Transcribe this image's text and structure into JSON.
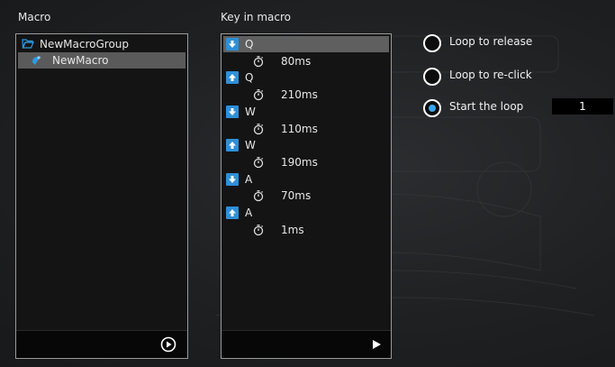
{
  "macro_panel": {
    "title": "Macro",
    "group_label": "NewMacroGroup",
    "item_label": "NewMacro",
    "play_icon": "play-circle-icon"
  },
  "keys_panel": {
    "title": "Key in macro",
    "events": [
      {
        "direction": "down",
        "key": "Q",
        "delay": "80ms"
      },
      {
        "direction": "up",
        "key": "Q",
        "delay": "210ms"
      },
      {
        "direction": "down",
        "key": "W",
        "delay": "110ms"
      },
      {
        "direction": "up",
        "key": "W",
        "delay": "190ms"
      },
      {
        "direction": "down",
        "key": "A",
        "delay": "70ms"
      },
      {
        "direction": "up",
        "key": "A",
        "delay": "1ms"
      }
    ],
    "play_icon": "play-triangle-icon"
  },
  "loop_options": {
    "options": [
      {
        "label": "Loop to release",
        "checked": false
      },
      {
        "label": "Loop to re-click",
        "checked": false
      },
      {
        "label": "Start the loop",
        "checked": true
      }
    ],
    "loop_count": "1"
  },
  "colors": {
    "accent": "#39a7ec",
    "key_arrow": "#2f8fd6",
    "selected_row": "#5a5a5a"
  }
}
